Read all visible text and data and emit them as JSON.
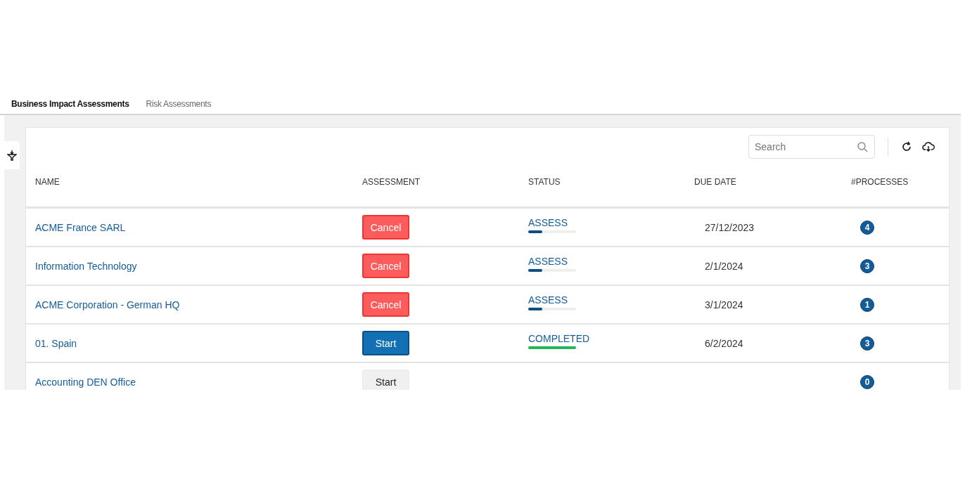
{
  "tabs": [
    {
      "label": "Business Impact Assessments",
      "selected": true
    },
    {
      "label": "Risk Assessments",
      "selected": false
    }
  ],
  "search": {
    "placeholder": "Search"
  },
  "table": {
    "columns": [
      "NAME",
      "ASSESSMENT",
      "STATUS",
      "DUE DATE",
      "#PROCESSES"
    ],
    "rows": [
      {
        "name": "ACME France SARL",
        "action": {
          "label": "Cancel",
          "kind": "cancel"
        },
        "status": {
          "label": "ASSESS",
          "level": 0.3,
          "color": "#0d4f85"
        },
        "due_date": "27/12/2023",
        "processes": "4"
      },
      {
        "name": "Information Technology",
        "action": {
          "label": "Cancel",
          "kind": "cancel"
        },
        "status": {
          "label": "ASSESS",
          "level": 0.3,
          "color": "#0d4f85"
        },
        "due_date": "2/1/2024",
        "processes": "3"
      },
      {
        "name": "ACME Corporation - German HQ",
        "action": {
          "label": "Cancel",
          "kind": "cancel"
        },
        "status": {
          "label": "ASSESS",
          "level": 0.3,
          "color": "#0d4f85"
        },
        "due_date": "3/1/2024",
        "processes": "1"
      },
      {
        "name": "01. Spain",
        "action": {
          "label": "Start",
          "kind": "primary"
        },
        "status": {
          "label": "COMPLETED",
          "level": 1,
          "color": "#1db954"
        },
        "due_date": "6/2/2024",
        "processes": "3"
      },
      {
        "name": "Accounting DEN Office",
        "action": {
          "label": "Start",
          "kind": "plain"
        },
        "processes": "0"
      }
    ]
  }
}
